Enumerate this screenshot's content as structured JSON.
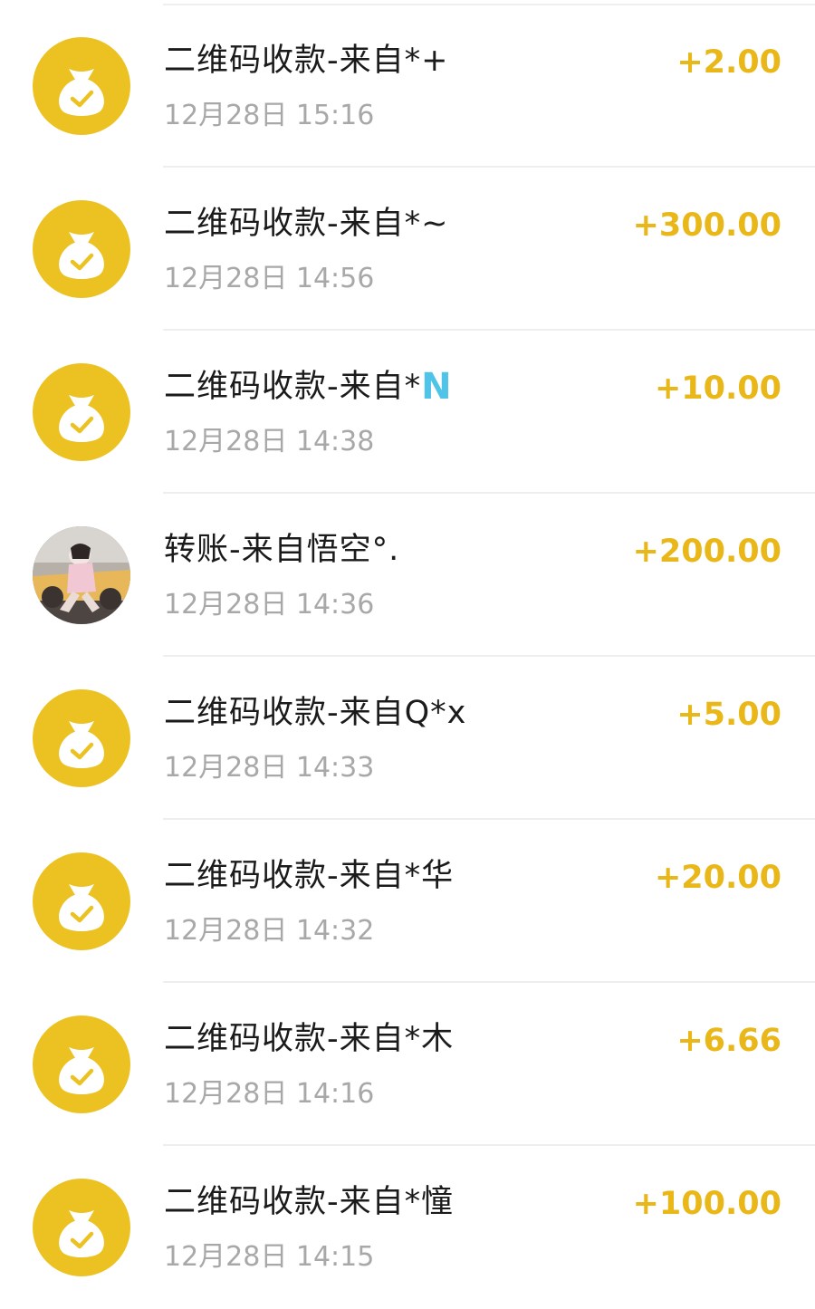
{
  "colors": {
    "accent_yellow": "#ecc223",
    "amount_yellow": "#e9b718",
    "title_text": "#1b1b1b",
    "time_text": "#a8a8a8",
    "tag_blue": "#4fc3e8",
    "divider": "#eeeeee"
  },
  "transactions": [
    {
      "icon": "money-bag-check-icon",
      "title": "二维码收款-来自*+",
      "tag": "",
      "time": "12月28日 15:16",
      "amount": "+2.00"
    },
    {
      "icon": "money-bag-check-icon",
      "title": "二维码收款-来自*~",
      "tag": "",
      "time": "12月28日 14:56",
      "amount": "+300.00"
    },
    {
      "icon": "money-bag-check-icon",
      "title": "二维码收款-来自*",
      "tag": "N",
      "time": "12月28日 14:38",
      "amount": "+10.00"
    },
    {
      "icon": "user-avatar-photo",
      "title": "转账-来自悟空°.",
      "tag": "",
      "time": "12月28日 14:36",
      "amount": "+200.00"
    },
    {
      "icon": "money-bag-check-icon",
      "title": "二维码收款-来自Q*x",
      "tag": "",
      "time": "12月28日 14:33",
      "amount": "+5.00"
    },
    {
      "icon": "money-bag-check-icon",
      "title": "二维码收款-来自*华",
      "tag": "",
      "time": "12月28日 14:32",
      "amount": "+20.00"
    },
    {
      "icon": "money-bag-check-icon",
      "title": "二维码收款-来自*木",
      "tag": "",
      "time": "12月28日 14:16",
      "amount": "+6.66"
    },
    {
      "icon": "money-bag-check-icon",
      "title": "二维码收款-来自*憧",
      "tag": "",
      "time": "12月28日 14:15",
      "amount": "+100.00"
    }
  ]
}
